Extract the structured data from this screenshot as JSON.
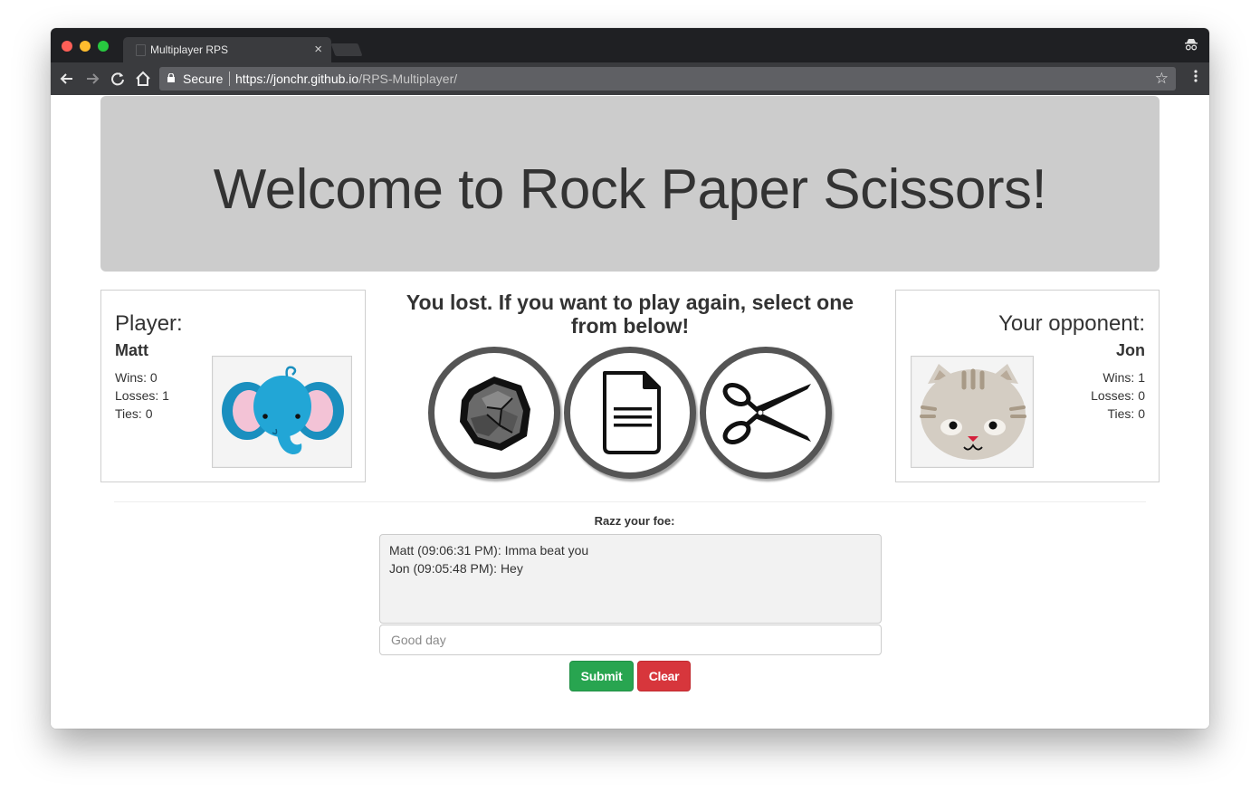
{
  "browser": {
    "tab_title": "Multiplayer RPS",
    "tab_close": "×",
    "secure_label": "Secure",
    "url_host": "https://jonchr.github.io",
    "url_path": "/RPS-Multiplayer/",
    "icons": [
      "back-icon",
      "forward-icon",
      "reload-icon",
      "home-icon",
      "lock-icon",
      "star-icon",
      "menu-icon",
      "incognito-icon"
    ]
  },
  "header": {
    "title": "Welcome to Rock Paper Scissors!"
  },
  "player": {
    "heading": "Player:",
    "name": "Matt",
    "wins": "Wins: 0",
    "losses": "Losses: 1",
    "ties": "Ties: 0",
    "avatar": "elephant"
  },
  "opponent": {
    "heading": "Your opponent:",
    "name": "Jon",
    "wins": "Wins: 1",
    "losses": "Losses: 0",
    "ties": "Ties: 0",
    "avatar": "cat"
  },
  "game": {
    "message": "You lost. If you want to play again, select one from below!",
    "choices": [
      "rock",
      "paper",
      "scissors"
    ]
  },
  "chat": {
    "heading": "Razz your foe:",
    "messages": [
      "Matt (09:06:31 PM): Imma beat you",
      "Jon (09:05:48 PM): Hey"
    ],
    "input_placeholder": "Good day",
    "submit_label": "Submit",
    "clear_label": "Clear"
  },
  "colors": {
    "jumbotron": "#cccccc",
    "submit": "#28a550",
    "clear": "#d7363c"
  }
}
